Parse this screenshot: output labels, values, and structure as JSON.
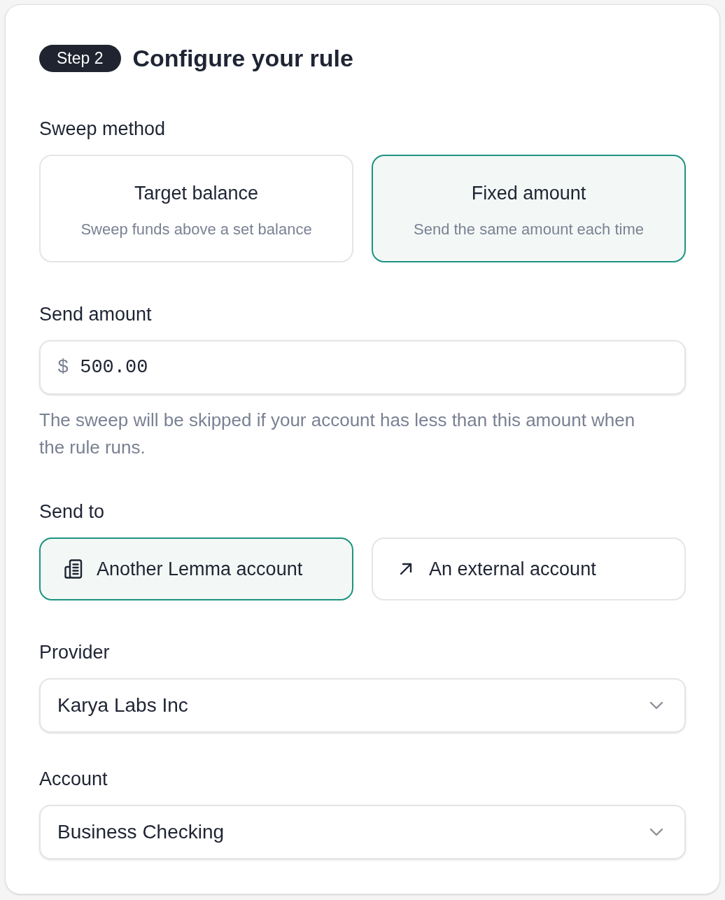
{
  "header": {
    "badge": "Step 2",
    "title": "Configure your rule"
  },
  "sweep_method": {
    "label": "Sweep method",
    "options": [
      {
        "title": "Target balance",
        "description": "Sweep funds above a set balance",
        "selected": false
      },
      {
        "title": "Fixed amount",
        "description": "Send the same amount each time",
        "selected": true
      }
    ]
  },
  "send_amount": {
    "label": "Send amount",
    "prefix": "$",
    "value": "500.00",
    "help": "The sweep will be skipped if your account has less than this amount when the rule runs."
  },
  "send_to": {
    "label": "Send to",
    "options": [
      {
        "kind": "internal",
        "label": "Another Lemma account",
        "selected": true
      },
      {
        "kind": "external",
        "label": "An external account",
        "selected": false
      }
    ]
  },
  "provider": {
    "label": "Provider",
    "value": "Karya Labs Inc"
  },
  "account": {
    "label": "Account",
    "value": "Business Checking"
  }
}
